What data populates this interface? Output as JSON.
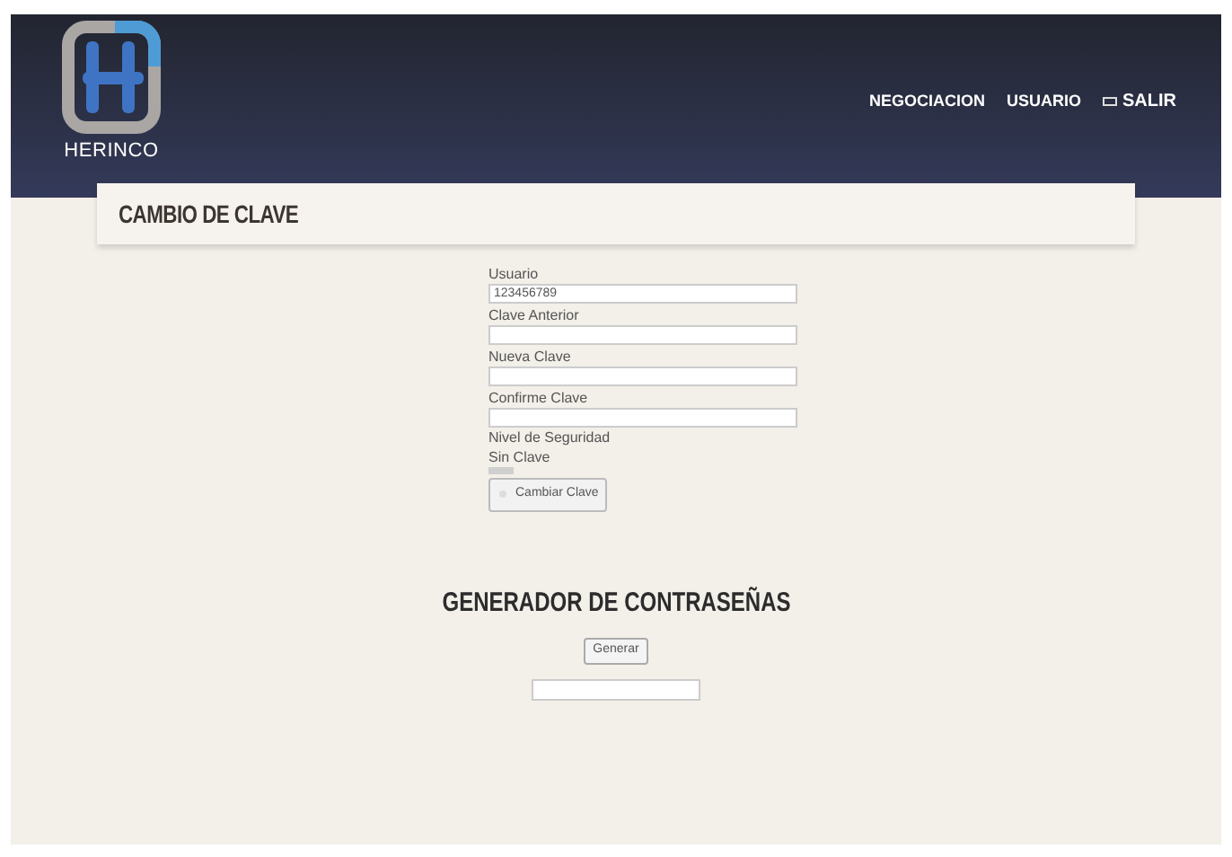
{
  "header": {
    "logo_text": "HERINCO",
    "nav": [
      {
        "label": "NEGOCIACION",
        "kind": "link"
      },
      {
        "label": "USUARIO",
        "kind": "link"
      },
      {
        "label": "SALIR",
        "kind": "logout"
      }
    ]
  },
  "page_title": "CAMBIO DE CLAVE",
  "form": {
    "fields": [
      {
        "label": "Usuario",
        "value": "123456789"
      },
      {
        "label": "Clave Anterior"
      },
      {
        "label": "Nueva Clave"
      },
      {
        "label": "Confirme Clave"
      }
    ],
    "strength_label": "Nivel de Seguridad",
    "strength_value": "Sin Clave",
    "submit": "Cambiar Clave"
  },
  "generator": {
    "title": "GENERADOR DE CONTRASEÑAS",
    "button": "Generar"
  }
}
